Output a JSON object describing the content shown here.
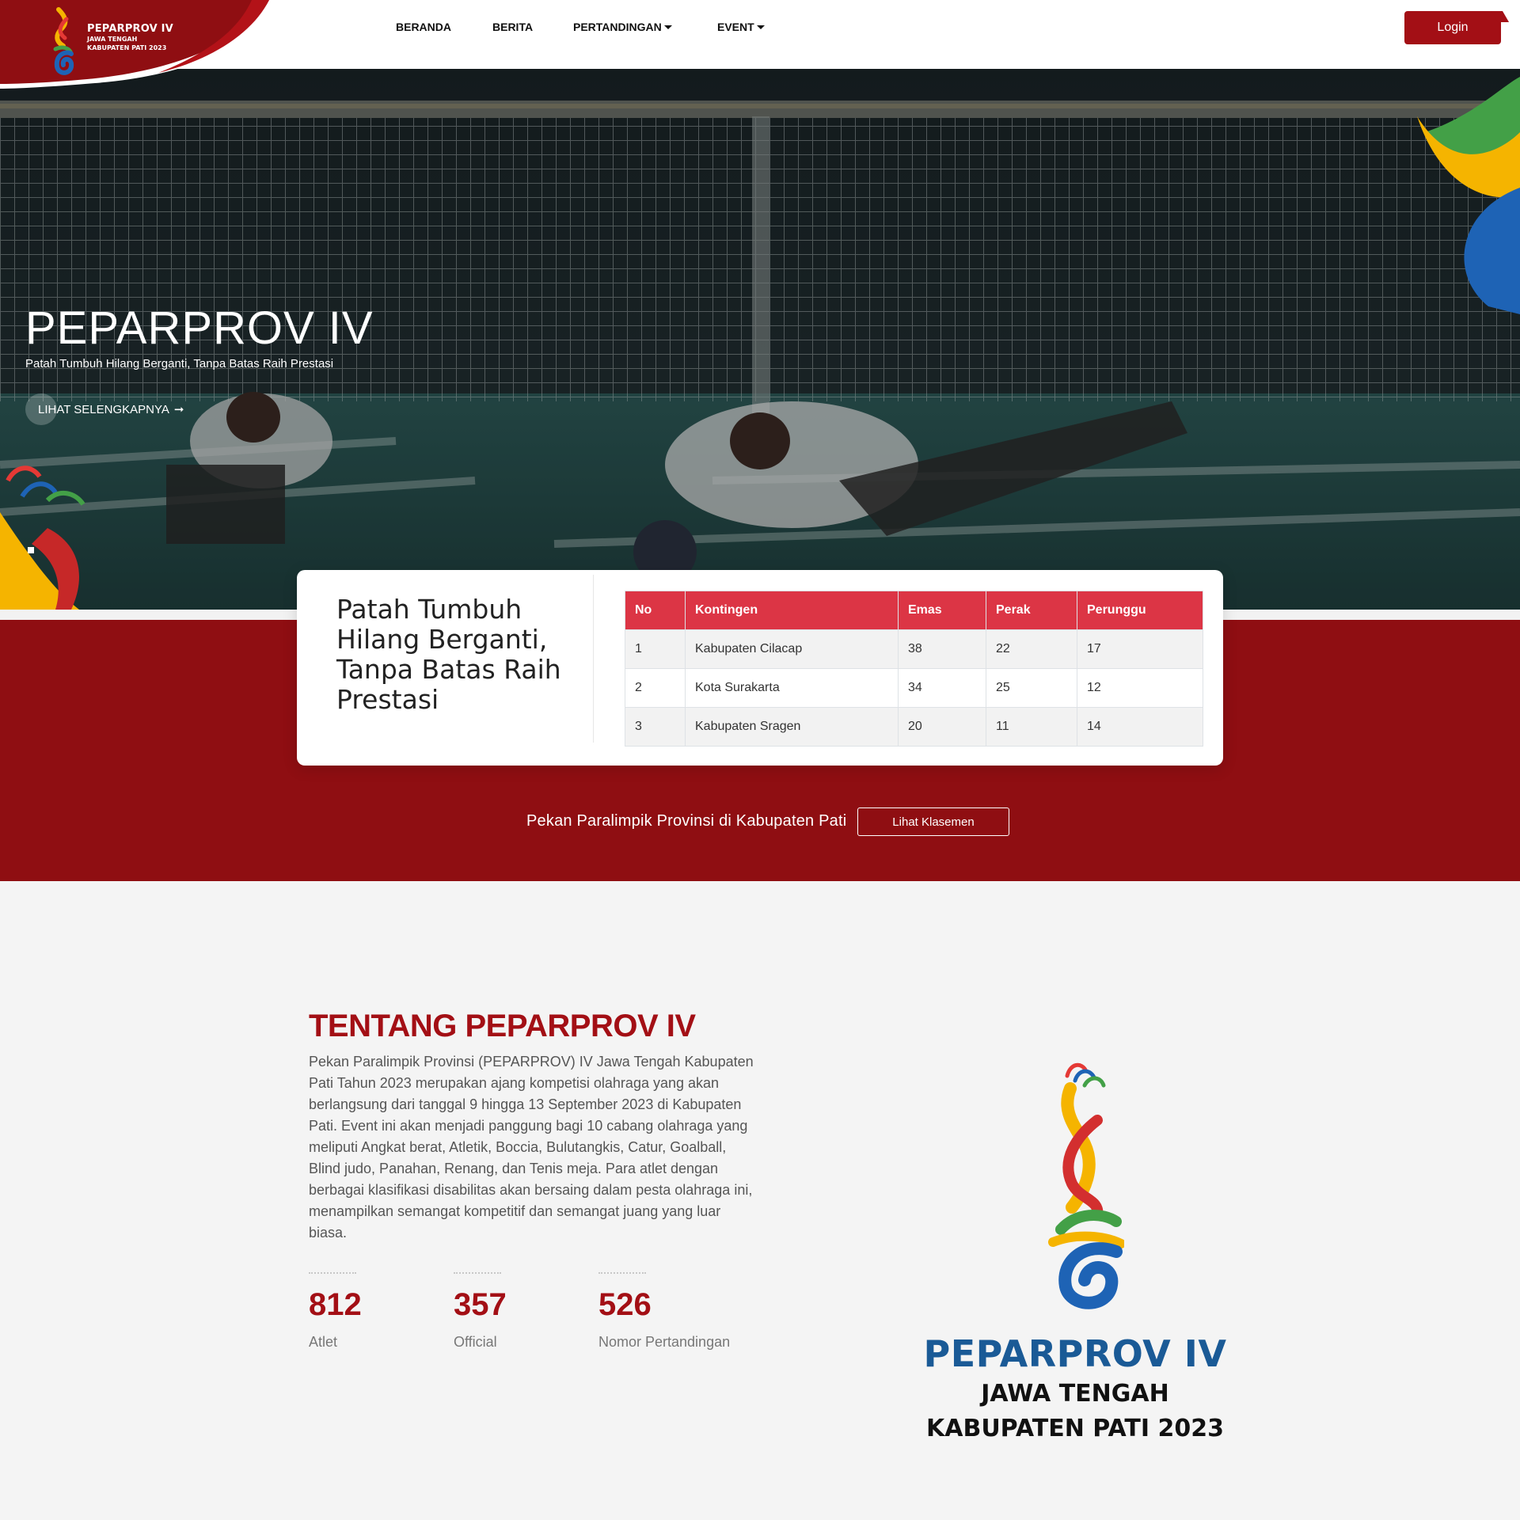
{
  "brand": {
    "name": "PEPARPROV IV",
    "line2": "JAWA TENGAH",
    "line3": "KABUPATEN PATI 2023"
  },
  "nav": {
    "items": [
      {
        "label": "BERANDA",
        "dropdown": false
      },
      {
        "label": "BERITA",
        "dropdown": false
      },
      {
        "label": "PERTANDINGAN",
        "dropdown": true
      },
      {
        "label": "EVENT",
        "dropdown": true
      }
    ],
    "login_label": "Login"
  },
  "hero": {
    "title": "PEPARPROV IV",
    "subtitle": "Patah Tumbuh Hilang Berganti, Tanpa Batas Raih Prestasi",
    "cta_label": "LIHAT SELENGKAPNYA",
    "cta_icon": "arrow-right-icon"
  },
  "card": {
    "title": "Patah Tumbuh Hilang Berganti, Tanpa Batas Raih Prestasi",
    "table": {
      "headers": [
        "No",
        "Kontingen",
        "Emas",
        "Perak",
        "Perunggu"
      ],
      "rows": [
        [
          "1",
          "Kabupaten Cilacap",
          "38",
          "22",
          "17"
        ],
        [
          "2",
          "Kota Surakarta",
          "34",
          "25",
          "12"
        ],
        [
          "3",
          "Kabupaten Sragen",
          "20",
          "11",
          "14"
        ]
      ]
    }
  },
  "band": {
    "text": "Pekan Paralimpik Provinsi di Kabupaten Pati",
    "button_label": "Lihat Klasemen"
  },
  "about": {
    "title": "TENTANG PEPARPROV IV",
    "body": "Pekan Paralimpik Provinsi (PEPARPROV) IV Jawa Tengah Kabupaten Pati Tahun 2023 merupakan ajang kompetisi olahraga yang akan berlangsung dari tanggal 9 hingga 13 September 2023 di Kabupaten Pati. Event ini akan menjadi panggung bagi 10 cabang olahraga yang meliputi Angkat berat, Atletik, Boccia, Bulutangkis, Catur, Goalball, Blind judo, Panahan, Renang, dan Tenis meja. Para atlet dengan berbagai klasifikasi disabilitas akan bersaing dalam pesta olahraga ini, menampilkan semangat kompetitif dan semangat juang yang luar biasa.",
    "stats": [
      {
        "value": "812",
        "label": "Atlet"
      },
      {
        "value": "357",
        "label": "Official"
      },
      {
        "value": "526",
        "label": "Nomor Pertandingan"
      }
    ]
  },
  "big_logo": {
    "title": "PEPARPROV IV",
    "line2": "JAWA TENGAH",
    "line3": "KABUPATEN PATI 2023"
  },
  "colors": {
    "brand_red": "#a30f15",
    "band_red": "#8f0e12",
    "table_header": "#dc3545",
    "logo_blue": "#1a5a96"
  }
}
